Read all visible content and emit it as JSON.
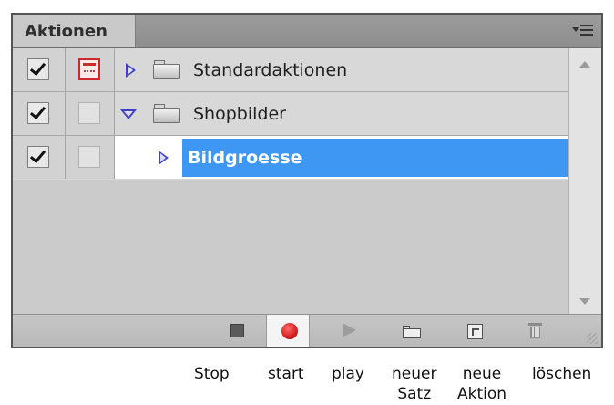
{
  "panel": {
    "tab_label": "Aktionen",
    "menu_icon": "panel-menu-icon"
  },
  "rows": [
    {
      "name": "Standardaktionen",
      "checked": true,
      "dialog_toggle": true,
      "expanded": false,
      "selected": false,
      "icon": "folder-icon"
    },
    {
      "name": "Shopbilder",
      "checked": true,
      "dialog_toggle": false,
      "expanded": true,
      "selected": false,
      "icon": "folder-icon"
    },
    {
      "name": "Bildgroesse",
      "checked": true,
      "dialog_toggle": false,
      "expanded": false,
      "selected": true,
      "icon": ""
    }
  ],
  "colors": {
    "selection": "#3d97f3",
    "expander": "#3f3fc9",
    "record": "#d11f1f",
    "dialog_toggle": "#cc2a2a"
  },
  "toolbar": {
    "buttons": [
      "stop-icon",
      "record-icon",
      "play-icon",
      "new-set-icon",
      "new-action-icon",
      "trash-icon"
    ],
    "active": "record"
  },
  "captions": {
    "stop": "Stop",
    "start": "start",
    "play": "play",
    "new_set_1": "neuer",
    "new_set_2": "Satz",
    "new_action_1": "neue",
    "new_action_2": "Aktion",
    "delete": "löschen"
  }
}
